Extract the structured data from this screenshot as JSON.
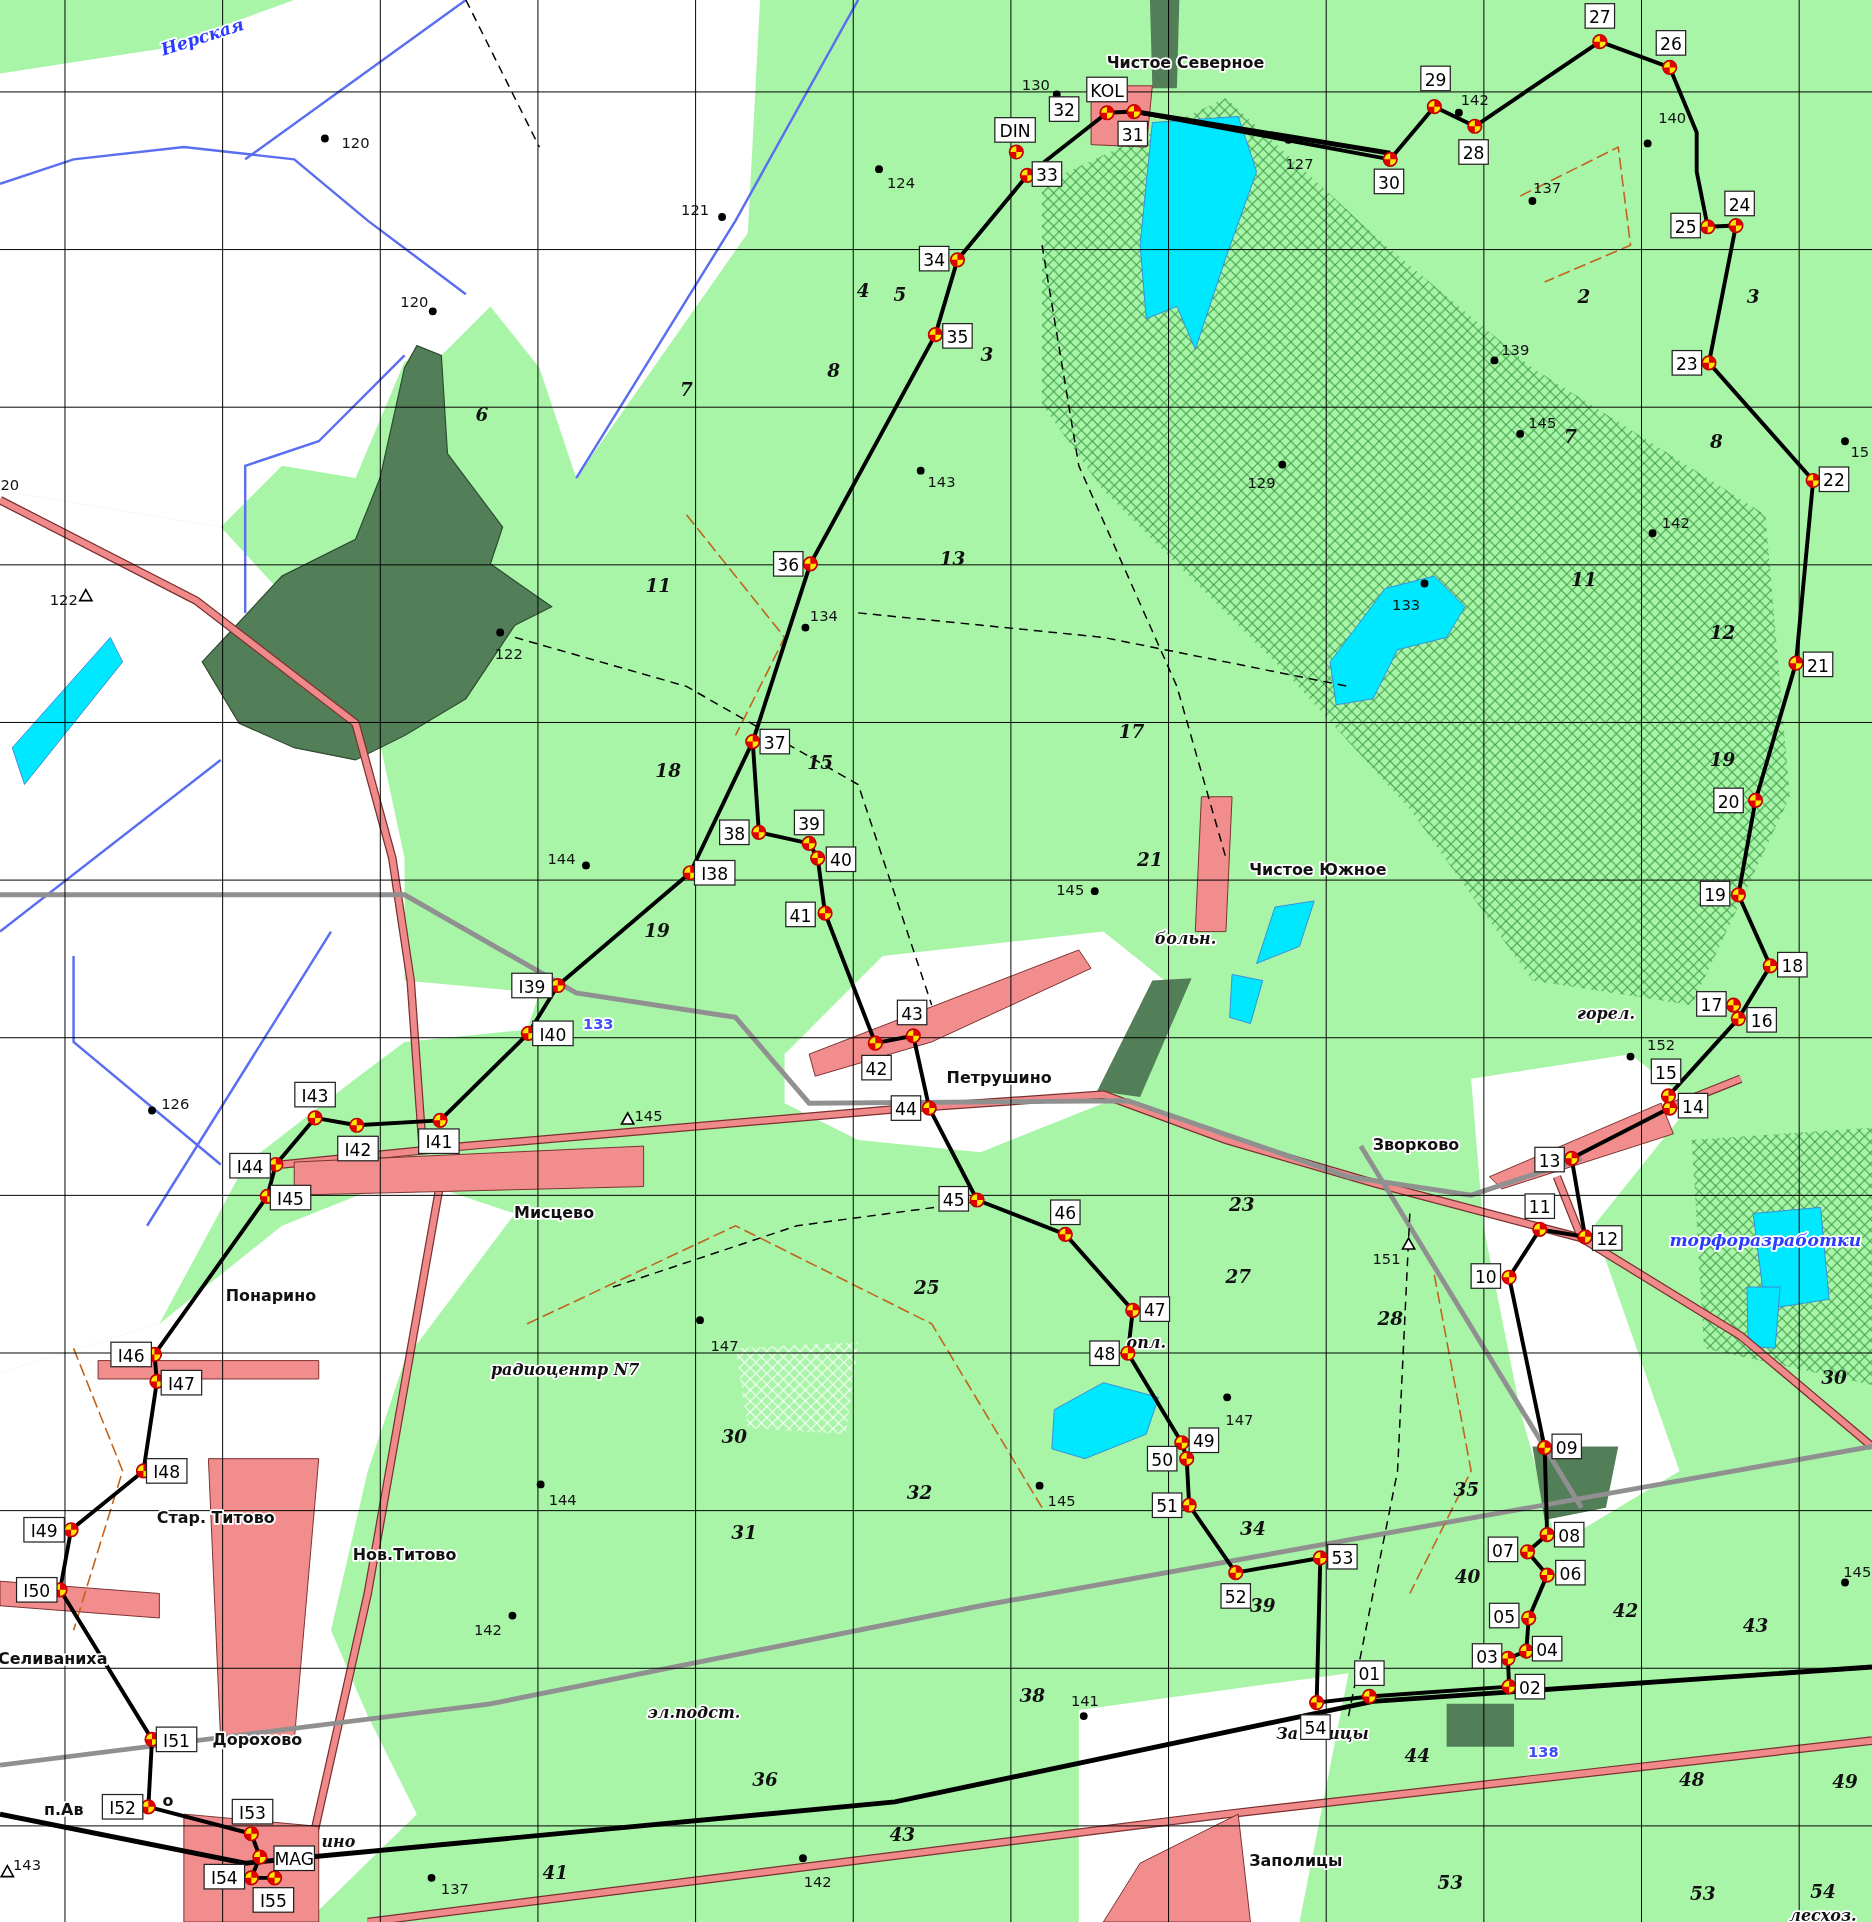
{
  "map": {
    "checkpoints": [
      {
        "label": "01"
      },
      {
        "label": "02"
      },
      {
        "label": "03"
      },
      {
        "label": "04"
      },
      {
        "label": "05"
      },
      {
        "label": "06"
      },
      {
        "label": "07"
      },
      {
        "label": "09"
      },
      {
        "label": "08"
      },
      {
        "label": "10"
      },
      {
        "label": "11"
      },
      {
        "label": "12"
      },
      {
        "label": "13"
      },
      {
        "label": "14"
      },
      {
        "label": "15"
      },
      {
        "label": "16"
      },
      {
        "label": "17"
      },
      {
        "label": "18"
      },
      {
        "label": "19"
      },
      {
        "label": "20"
      },
      {
        "label": "21"
      },
      {
        "label": "22"
      },
      {
        "label": "23"
      },
      {
        "label": "24"
      },
      {
        "label": "25"
      },
      {
        "label": "26"
      },
      {
        "label": "27"
      },
      {
        "label": "28"
      },
      {
        "label": "29"
      },
      {
        "label": "30"
      },
      {
        "label": "31"
      },
      {
        "label": "32"
      },
      {
        "label": "33"
      },
      {
        "label": "34"
      },
      {
        "label": "35"
      },
      {
        "label": "36"
      },
      {
        "label": "37"
      },
      {
        "label": "38"
      },
      {
        "label": "39"
      },
      {
        "label": "40"
      },
      {
        "label": "41"
      },
      {
        "label": "42"
      },
      {
        "label": "43"
      },
      {
        "label": "44"
      },
      {
        "label": "45"
      },
      {
        "label": "46"
      },
      {
        "label": "47"
      },
      {
        "label": "48"
      },
      {
        "label": "49"
      },
      {
        "label": "50"
      },
      {
        "label": "51"
      },
      {
        "label": "52"
      },
      {
        "label": "53"
      },
      {
        "label": "54"
      },
      {
        "label": "I38"
      },
      {
        "label": "I39"
      },
      {
        "label": "I40"
      },
      {
        "label": "I41"
      },
      {
        "label": "I42"
      },
      {
        "label": "I43"
      },
      {
        "label": "I44"
      },
      {
        "label": "I45"
      },
      {
        "label": "I46"
      },
      {
        "label": "I47"
      },
      {
        "label": "I48"
      },
      {
        "label": "I49"
      },
      {
        "label": "I50"
      },
      {
        "label": "I51"
      },
      {
        "label": "I52"
      },
      {
        "label": "I53"
      },
      {
        "label": "I54"
      },
      {
        "label": "I55"
      },
      {
        "label": "KOL"
      },
      {
        "label": "DIN"
      },
      {
        "label": "MAG"
      }
    ],
    "place_names": [
      {
        "text": "Нерская",
        "kind": "water"
      },
      {
        "text": "Чистое Северное",
        "kind": "settlement"
      },
      {
        "text": "Чистое Южное",
        "kind": "settlement"
      },
      {
        "text": "больн.",
        "kind": "feature"
      },
      {
        "text": "Петрушино",
        "kind": "settlement"
      },
      {
        "text": "Зворково",
        "kind": "settlement"
      },
      {
        "text": "Мисцево",
        "kind": "settlement"
      },
      {
        "text": "Понарино",
        "kind": "settlement"
      },
      {
        "text": "радиоцентр N7",
        "kind": "feature"
      },
      {
        "text": "Стар. Титово",
        "kind": "settlement"
      },
      {
        "text": "Нов.Титово",
        "kind": "settlement"
      },
      {
        "text": "Селиваниха",
        "kind": "settlement"
      },
      {
        "text": "Дорохово",
        "kind": "settlement"
      },
      {
        "text": "п.Ав",
        "kind": "settlement"
      },
      {
        "text": "о",
        "kind": "settlement"
      },
      {
        "text": "ино",
        "kind": "feature"
      },
      {
        "text": "За",
        "kind": "feature"
      },
      {
        "text": "ицы",
        "kind": "feature"
      },
      {
        "text": "Заполицы",
        "kind": "settlement"
      },
      {
        "text": "горел.",
        "kind": "feature"
      },
      {
        "text": "торфоразработки",
        "kind": "water"
      },
      {
        "text": "эл.подст.",
        "kind": "feature"
      },
      {
        "text": "опл.",
        "kind": "feature"
      },
      {
        "text": "лесхоз.",
        "kind": "feature"
      }
    ],
    "spot_heights": [
      {
        "text": "120",
        "kind": "dot"
      },
      {
        "text": "130",
        "kind": "dot"
      },
      {
        "text": "142",
        "kind": "dot"
      },
      {
        "text": "140",
        "kind": "dot"
      },
      {
        "text": "121",
        "kind": "dot"
      },
      {
        "text": "124",
        "kind": "dot"
      },
      {
        "text": "127",
        "kind": "dot"
      },
      {
        "text": "137",
        "kind": "dot"
      },
      {
        "text": "120",
        "kind": "dot"
      },
      {
        "text": "139",
        "kind": "dot"
      },
      {
        "text": "145",
        "kind": "dot"
      },
      {
        "text": "15",
        "kind": "dot"
      },
      {
        "text": "20",
        "kind": "plain"
      },
      {
        "text": "143",
        "kind": "dot"
      },
      {
        "text": "129",
        "kind": "dot"
      },
      {
        "text": "142",
        "kind": "dot"
      },
      {
        "text": "122",
        "kind": "triangle"
      },
      {
        "text": "133",
        "kind": "dot"
      },
      {
        "text": "134",
        "kind": "dot"
      },
      {
        "text": "122",
        "kind": "dot"
      },
      {
        "text": "144",
        "kind": "dot"
      },
      {
        "text": "145",
        "kind": "dot"
      },
      {
        "text": "133",
        "kind": "water"
      },
      {
        "text": "152",
        "kind": "dot"
      },
      {
        "text": "126",
        "kind": "dot"
      },
      {
        "text": "145",
        "kind": "triangle"
      },
      {
        "text": "151",
        "kind": "triangle"
      },
      {
        "text": "147",
        "kind": "dot"
      },
      {
        "text": "147",
        "kind": "dot"
      },
      {
        "text": "144",
        "kind": "dot"
      },
      {
        "text": "145",
        "kind": "dot"
      },
      {
        "text": "145",
        "kind": "dot"
      },
      {
        "text": "142",
        "kind": "dot"
      },
      {
        "text": "141",
        "kind": "dot"
      },
      {
        "text": "138",
        "kind": "water"
      },
      {
        "text": "143",
        "kind": "triangle"
      },
      {
        "text": "137",
        "kind": "dot"
      },
      {
        "text": "142",
        "kind": "dot"
      }
    ],
    "quarter_numbers": [
      "6",
      "7",
      "4",
      "5",
      "8",
      "3",
      "2",
      "3",
      "7",
      "8",
      "11",
      "13",
      "11",
      "12",
      "18",
      "15",
      "17",
      "19",
      "21",
      "19",
      "23",
      "27",
      "25",
      "28",
      "30",
      "30",
      "32",
      "35",
      "31",
      "34",
      "40",
      "39",
      "42",
      "43",
      "38",
      "44",
      "36",
      "48",
      "49",
      "43",
      "41",
      "53",
      "53",
      "54"
    ]
  }
}
